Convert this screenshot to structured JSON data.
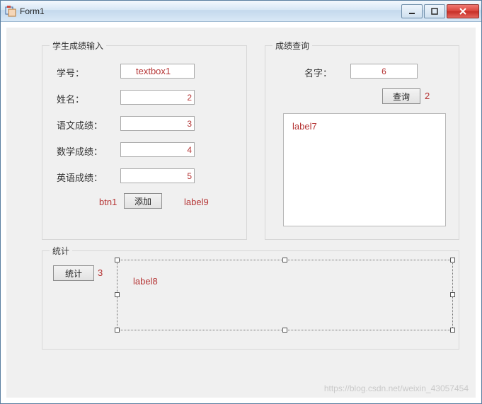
{
  "window": {
    "title": "Form1"
  },
  "group_input": {
    "legend": "学生成绩输入",
    "rows": [
      {
        "label": "学号：",
        "annot": "textbox1"
      },
      {
        "label": "姓名：",
        "annot": "2"
      },
      {
        "label": "语文成绩：",
        "annot": "3"
      },
      {
        "label": "数学成绩：",
        "annot": "4"
      },
      {
        "label": "英语成绩：",
        "annot": "5"
      }
    ],
    "add_button": "添加",
    "add_button_annot": "btn1",
    "label9_annot": "label9"
  },
  "group_query": {
    "legend": "成绩查询",
    "name_label": "名字：",
    "name_annot": "6",
    "query_button": "查询",
    "query_button_annot": "2",
    "result_label": "label7"
  },
  "group_stat": {
    "legend": "统计",
    "stat_button": "统计",
    "stat_button_annot": "3",
    "label8_annot": "label8"
  },
  "watermark": "https://blog.csdn.net/weixin_43057454"
}
